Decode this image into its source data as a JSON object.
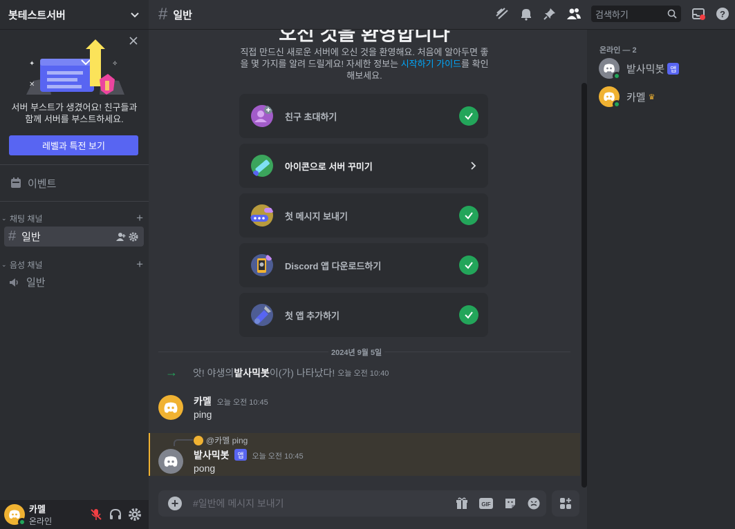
{
  "server": {
    "name": "봇테스트서버"
  },
  "boost": {
    "text": "서버 부스트가 생겼어요! 친구들과 함께 서버를 부스트하세요.",
    "button": "레벨과 특전 보기"
  },
  "sidebar": {
    "events": "이벤트",
    "text_category": "채팅 채널",
    "text_channel": "일반",
    "voice_category": "음성 채널",
    "voice_channel": "일반"
  },
  "user": {
    "name": "카멜",
    "status": "온라인"
  },
  "topbar": {
    "channel": "일반",
    "search_placeholder": "검색하기"
  },
  "welcome": {
    "title": "오신 것을 환영합니다",
    "desc_1": "직접 만드신 새로운 서버에 오신 것을 환영해요. 처음에 알아두면 좋을 몇 가지를 알려 드릴게요! 자세한 정보는 ",
    "desc_link": "시작하기 가이드",
    "desc_2": "를 확인해보세요."
  },
  "tasks": [
    {
      "label": "친구 초대하기",
      "done": true
    },
    {
      "label": "아이콘으로 서버 꾸미기",
      "done": false
    },
    {
      "label": "첫 메시지 보내기",
      "done": true
    },
    {
      "label": "Discord 앱 다운로드하기",
      "done": true
    },
    {
      "label": "첫 앱 추가하기",
      "done": true
    }
  ],
  "chat": {
    "date": "2024년 9월 5일",
    "system": {
      "prefix": "앗! 야생의 ",
      "bot": "밭사믹봇",
      "suffix": "이(가) 나타났다!",
      "time": "오늘 오전 10:40"
    },
    "msg1": {
      "author": "카멜",
      "time": "오늘 오전 10:45",
      "content": "ping"
    },
    "msg2": {
      "reply_author": "@카멜",
      "reply_text": "ping",
      "author": "밭사믹봇",
      "tag": "앱",
      "time": "오늘 오전 10:45",
      "content": "pong"
    }
  },
  "composer": {
    "placeholder": "#일반에 메시지 보내기"
  },
  "members": {
    "header": "온라인 — 2",
    "list": [
      {
        "name": "밭사믹봇",
        "tag": "앱",
        "color": "#80848e"
      },
      {
        "name": "카멜",
        "owner_icon": "crown-icon",
        "color": "#f0b232"
      }
    ]
  },
  "colors": {
    "accent": "#5865f2",
    "online": "#23a55a",
    "link": "#00a8fc",
    "mention": "#f0b232"
  }
}
